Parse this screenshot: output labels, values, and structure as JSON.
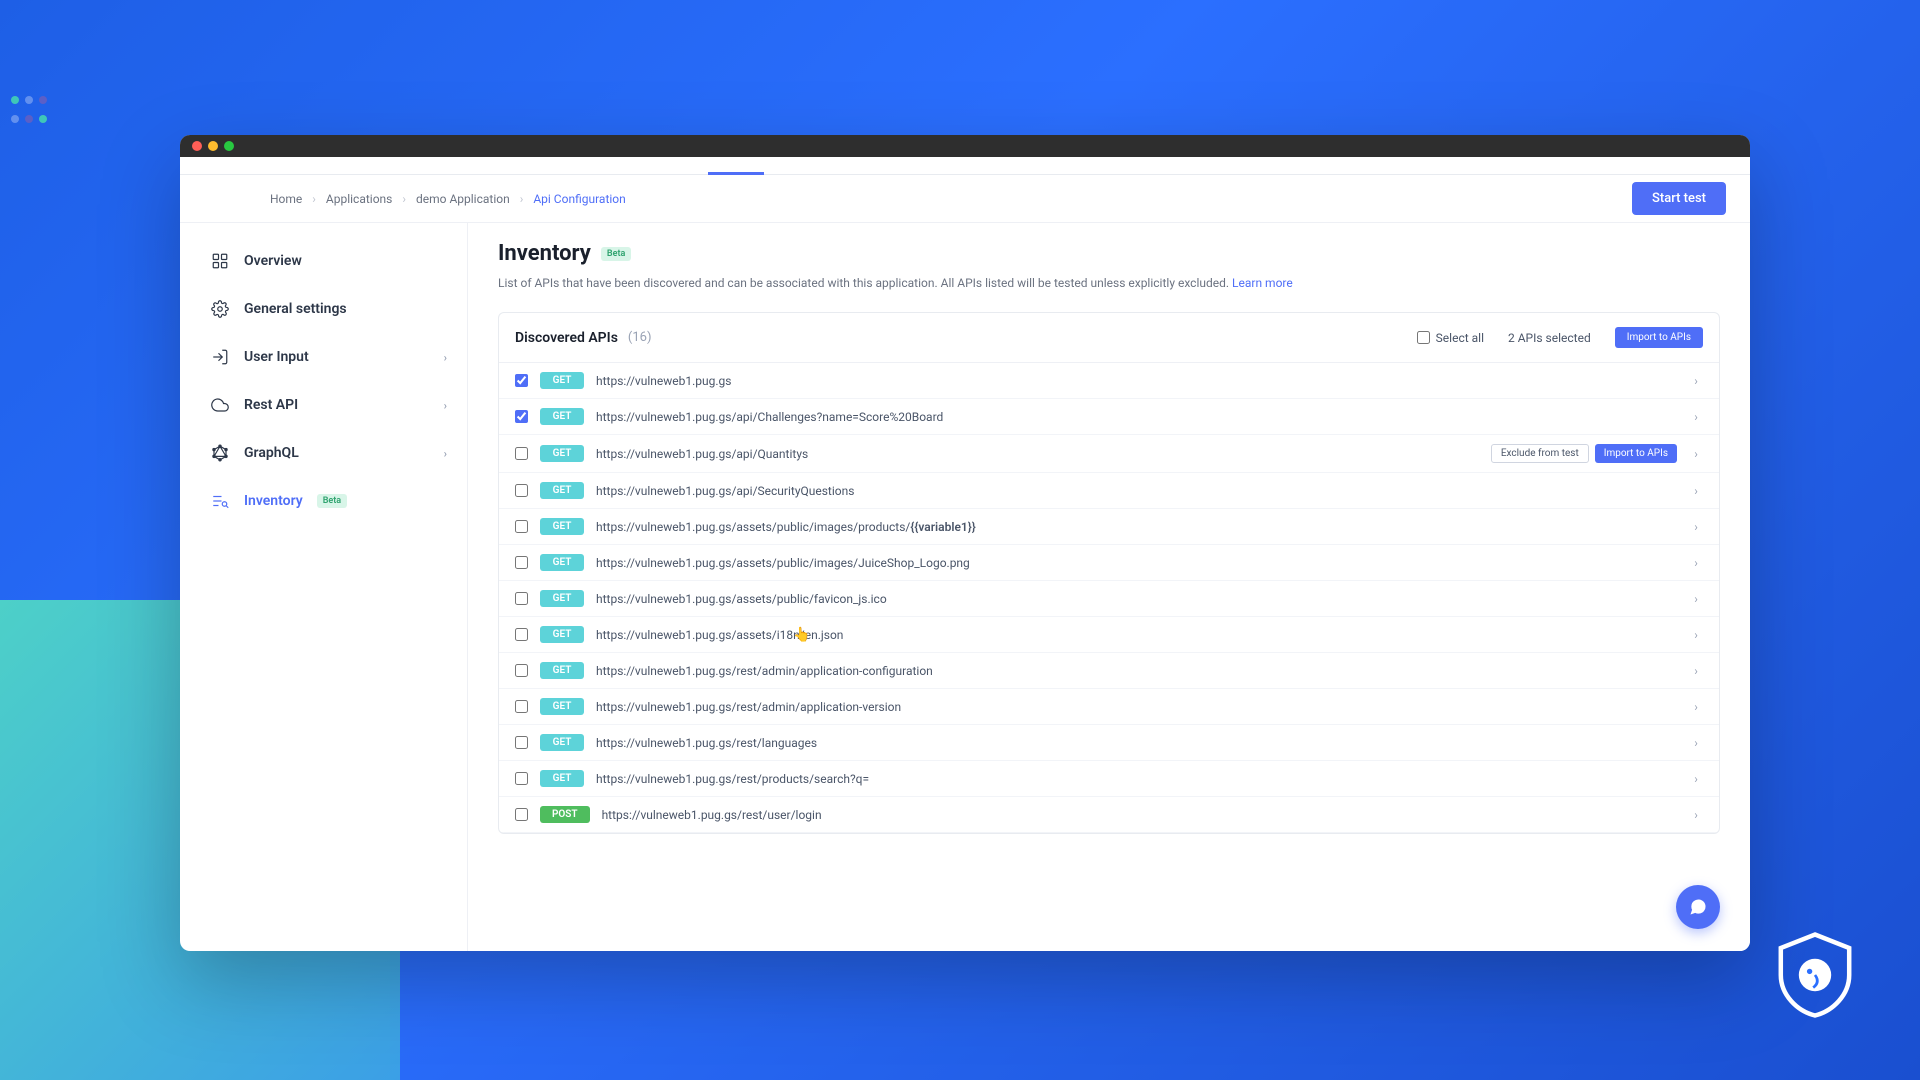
{
  "breadcrumb": {
    "home": "Home",
    "applications": "Applications",
    "app": "demo Application",
    "current": "Api Configuration"
  },
  "header": {
    "start_test": "Start test"
  },
  "sidebar": {
    "overview": "Overview",
    "general": "General settings",
    "user_input": "User Input",
    "rest_api": "Rest API",
    "graphql": "GraphQL",
    "inventory": "Inventory",
    "beta_badge": "Beta"
  },
  "page": {
    "title": "Inventory",
    "title_badge": "Beta",
    "desc_pre": "List of APIs that have been discovered and can be associated with this application. All APIs listed will be tested unless explicitly excluded. ",
    "learn_more": "Learn more"
  },
  "panel": {
    "title": "Discovered APIs",
    "count": "(16)",
    "select_all": "Select all",
    "selected": "2 APIs selected",
    "import_btn": "Import to APIs",
    "exclude_btn": "Exclude from test",
    "import_sm": "Import to APIs"
  },
  "apis": [
    {
      "method": "GET",
      "url": "https://vulneweb1.pug.gs",
      "checked": true
    },
    {
      "method": "GET",
      "url": "https://vulneweb1.pug.gs/api/Challenges?name=Score%20Board",
      "checked": true
    },
    {
      "method": "GET",
      "url": "https://vulneweb1.pug.gs/api/Quantitys",
      "checked": false,
      "hovered": true
    },
    {
      "method": "GET",
      "url": "https://vulneweb1.pug.gs/api/SecurityQuestions",
      "checked": false
    },
    {
      "method": "GET",
      "url": "https://vulneweb1.pug.gs/assets/public/images/products/{{variable1}}",
      "checked": false,
      "hasVar": true
    },
    {
      "method": "GET",
      "url": "https://vulneweb1.pug.gs/assets/public/images/JuiceShop_Logo.png",
      "checked": false
    },
    {
      "method": "GET",
      "url": "https://vulneweb1.pug.gs/assets/public/favicon_js.ico",
      "checked": false
    },
    {
      "method": "GET",
      "url": "https://vulneweb1.pug.gs/assets/i18n/en.json",
      "checked": false
    },
    {
      "method": "GET",
      "url": "https://vulneweb1.pug.gs/rest/admin/application-configuration",
      "checked": false
    },
    {
      "method": "GET",
      "url": "https://vulneweb1.pug.gs/rest/admin/application-version",
      "checked": false
    },
    {
      "method": "GET",
      "url": "https://vulneweb1.pug.gs/rest/languages",
      "checked": false
    },
    {
      "method": "GET",
      "url": "https://vulneweb1.pug.gs/rest/products/search?q=",
      "checked": false
    },
    {
      "method": "POST",
      "url": "https://vulneweb1.pug.gs/rest/user/login",
      "checked": false
    }
  ]
}
